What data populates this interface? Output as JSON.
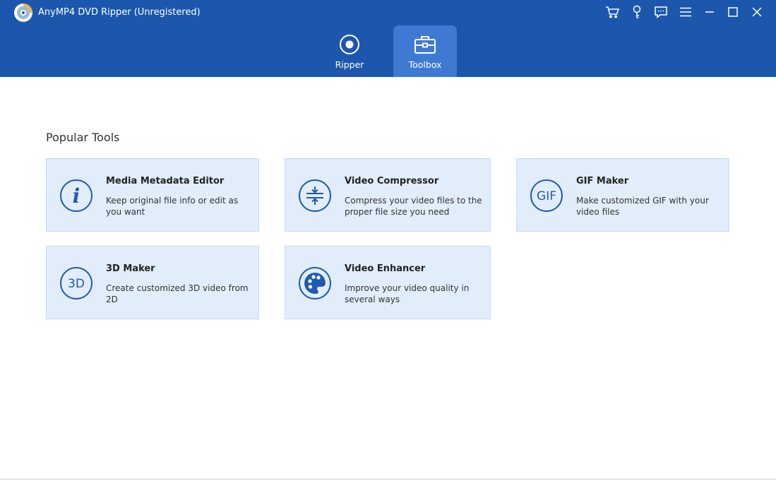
{
  "app": {
    "title": "AnyMP4 DVD Ripper (Unregistered)",
    "logo_icon": "dvd-disc-icon"
  },
  "window_controls": [
    {
      "name": "cart-icon"
    },
    {
      "name": "key-icon"
    },
    {
      "name": "feedback-icon"
    },
    {
      "name": "menu-icon"
    },
    {
      "name": "minimize-icon"
    },
    {
      "name": "maximize-icon"
    },
    {
      "name": "close-icon"
    }
  ],
  "tabs": [
    {
      "label": "Ripper",
      "icon": "ripper-disc-icon",
      "active": false
    },
    {
      "label": "Toolbox",
      "icon": "toolbox-icon",
      "active": true
    }
  ],
  "section": {
    "title": "Popular Tools"
  },
  "tools": [
    {
      "title": "Media Metadata Editor",
      "desc": "Keep original file info or edit as you want",
      "icon": "info-icon"
    },
    {
      "title": "Video Compressor",
      "desc": "Compress your video files to the proper file size you need",
      "icon": "compress-icon"
    },
    {
      "title": "GIF Maker",
      "desc": "Make customized GIF with your video files",
      "icon": "gif-icon",
      "icon_text": "GIF"
    },
    {
      "title": "3D Maker",
      "desc": "Create customized 3D video from 2D",
      "icon": "3d-icon",
      "icon_text": "3D"
    },
    {
      "title": "Video Enhancer",
      "desc": "Improve your video quality in several ways",
      "icon": "palette-icon"
    }
  ],
  "colors": {
    "header": "#1c57ad",
    "active_tab": "#3e7ad3",
    "card_bg": "#e2edfb",
    "icon": "#1f5bb0"
  }
}
